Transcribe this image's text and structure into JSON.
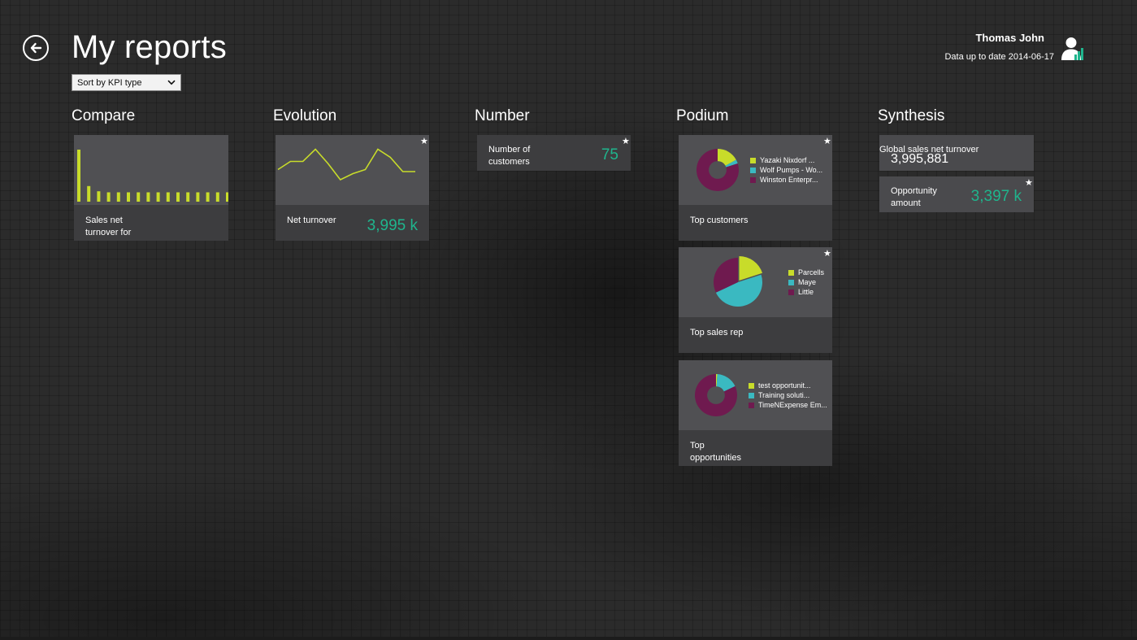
{
  "page": {
    "title": "My reports"
  },
  "sort": {
    "label": "Sort by KPI type"
  },
  "user": {
    "name": "Thomas John",
    "data_date": "Data up to date 2014-06-17"
  },
  "colors": {
    "accent_green": "#1fb58d",
    "lime": "#c8dc2a",
    "teal": "#3ab9c1",
    "plum": "#6f1a4f"
  },
  "sections": {
    "compare": "Compare",
    "evolution": "Evolution",
    "number": "Number",
    "podium": "Podium",
    "synthesis": "Synthesis"
  },
  "tiles": {
    "sales_net_turnover": {
      "label": "Sales net turnover for",
      "bars": [
        1.0,
        0.3,
        0.2,
        0.18,
        0.18,
        0.18,
        0.18,
        0.18,
        0.18,
        0.18,
        0.18,
        0.18,
        0.18,
        0.18,
        0.18,
        0.18
      ]
    },
    "net_turnover": {
      "label": "Net turnover",
      "value": "3,995 k",
      "trend": [
        0.35,
        0.55,
        0.55,
        0.85,
        0.5,
        0.1,
        0.25,
        0.35,
        0.85,
        0.65,
        0.3,
        0.3
      ]
    },
    "number_of_customers": {
      "label": "Number of customers",
      "value": "75"
    },
    "top_customers": {
      "label": "Top customers",
      "legend": [
        "Yazaki Nixdorf ...",
        "Wolf Pumps - Wo...",
        "Winston Enterpr..."
      ],
      "shares": [
        0.17,
        0.03,
        0.8
      ]
    },
    "top_sales_rep": {
      "label": "Top sales rep",
      "legend": [
        "Parcells",
        "Maye",
        "Little"
      ],
      "shares": [
        0.2,
        0.48,
        0.32
      ]
    },
    "top_opportunities": {
      "label": "Top opportunities",
      "legend": [
        "test opportunit...",
        "Training soluti...",
        "TimeNExpense Em..."
      ],
      "shares": [
        0.01,
        0.17,
        0.82
      ]
    },
    "global_sales": {
      "label": "Global sales net turnover",
      "value": "3,995,881"
    },
    "opportunity_amount": {
      "label": "Opportunity amount",
      "value": "3,397 k"
    }
  },
  "icons": {
    "back": "arrow-left-circle-icon",
    "favorite": "star-icon",
    "user": "user-chart-icon",
    "dropdown": "chevron-down-icon"
  }
}
